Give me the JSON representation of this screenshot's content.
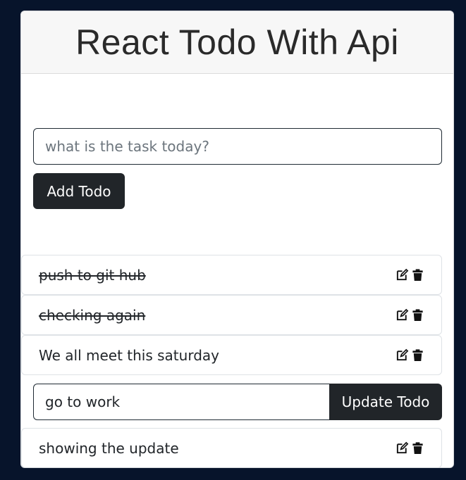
{
  "header": {
    "title": "React Todo With Api"
  },
  "form": {
    "placeholder": "what is the task today?",
    "add_label": "Add Todo"
  },
  "todos": [
    {
      "text": "push to git hub",
      "completed": true
    },
    {
      "text": "checking again",
      "completed": true
    },
    {
      "text": "We all meet this saturday",
      "completed": false
    },
    {
      "text": "showing the update",
      "completed": false
    }
  ],
  "edit": {
    "value": "go to work",
    "update_label": "Update Todo"
  },
  "icons": {
    "edit": "edit-icon",
    "delete": "trash-icon"
  },
  "colors": {
    "background": "#07142b",
    "button": "#212529",
    "header_bg": "#f7f7f7"
  }
}
